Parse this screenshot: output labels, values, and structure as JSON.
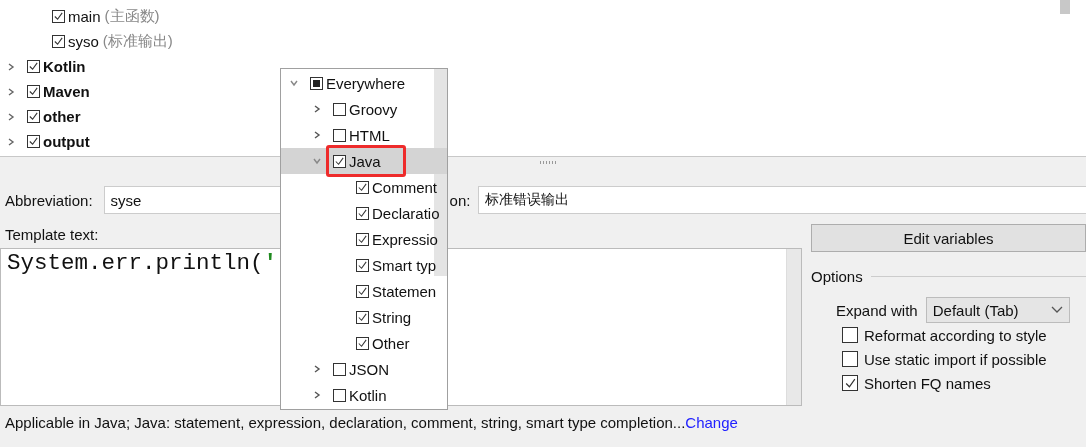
{
  "template_tree": [
    {
      "kind": "template",
      "label": "main",
      "note": "(主函数)",
      "checked": true,
      "bold": false
    },
    {
      "kind": "template",
      "label": "syso",
      "note": "(标准输出)",
      "checked": true,
      "bold": false
    },
    {
      "kind": "group",
      "label": "Kotlin",
      "checked": true,
      "bold": true,
      "expanded": false
    },
    {
      "kind": "group",
      "label": "Maven",
      "checked": true,
      "bold": true,
      "expanded": false
    },
    {
      "kind": "group",
      "label": "other",
      "checked": true,
      "bold": true,
      "expanded": false
    },
    {
      "kind": "group",
      "label": "output",
      "checked": true,
      "bold": true,
      "expanded": false
    }
  ],
  "abbreviation": {
    "label": "Abbreviation:",
    "value": "syse"
  },
  "description": {
    "label": "on:",
    "value": "标准错误输出"
  },
  "template_text": {
    "label": "Template text:",
    "code": "System.err.println(",
    "string_start": "'"
  },
  "edit_variables_button": "Edit variables",
  "options": {
    "title": "Options",
    "expand_label": "Expand with",
    "expand_value": "Default (Tab)",
    "checkboxes": [
      {
        "label": "Reformat according to style",
        "checked": false
      },
      {
        "label": "Use static import if possible",
        "checked": false
      },
      {
        "label": "Shorten FQ names",
        "checked": true
      }
    ]
  },
  "context_popup": {
    "items": [
      {
        "label": "Everywhere",
        "checked": false,
        "partial": true,
        "expanded": true,
        "selected": false,
        "children": [
          {
            "label": "Groovy",
            "checked": false,
            "expanded": false,
            "selected": false
          },
          {
            "label": "HTML",
            "checked": false,
            "expanded": false,
            "selected": false
          },
          {
            "label": "Java",
            "checked": true,
            "expanded": true,
            "selected": true,
            "highlighted": true,
            "children": [
              {
                "label": "Comment",
                "checked": true,
                "selected": false
              },
              {
                "label": "Declaratio",
                "checked": true,
                "selected": false
              },
              {
                "label": "Expressio",
                "checked": true,
                "selected": false
              },
              {
                "label": "Smart typ",
                "checked": true,
                "selected": false
              },
              {
                "label": "Statemen",
                "checked": true,
                "selected": false
              },
              {
                "label": "String",
                "checked": true,
                "selected": false
              },
              {
                "label": "Other",
                "checked": true,
                "selected": false
              }
            ]
          },
          {
            "label": "JSON",
            "checked": false,
            "expanded": false,
            "selected": false
          },
          {
            "label": "Kotlin",
            "checked": false,
            "expanded": false,
            "selected": false
          }
        ]
      }
    ]
  },
  "status": {
    "text": "Applicable in Java; Java: statement, expression, declaration, comment, string, smart type completion...",
    "link": "Change"
  }
}
